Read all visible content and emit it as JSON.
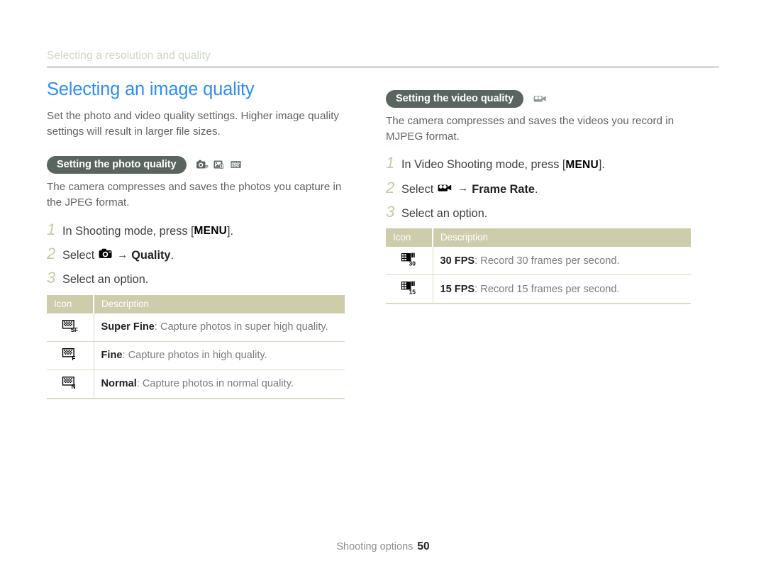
{
  "breadcrumb": "Selecting a resolution and quality",
  "page_title": "Selecting an image quality",
  "intro": "Set the photo and video quality settings. Higher image quality settings will result in larger file sizes.",
  "colors": {
    "heading_blue": "#2e8ef0",
    "badge_slate": "#5b6560",
    "table_header_khaki": "#cdccab",
    "step_number_sage": "#c2cba6",
    "breadcrumb_sage": "#cfd6c4",
    "body_gray": "#636466"
  },
  "photo_section": {
    "badge": "Setting the photo quality",
    "mode_icons": [
      "program-mode-icon",
      "dual-is-mode-icon",
      "scene-mode-icon"
    ],
    "body": "The camera compresses and saves the photos you capture in the JPEG format.",
    "steps": [
      {
        "number": "1",
        "prefix": "In Shooting mode, press [",
        "key": "MENU",
        "suffix": "]."
      },
      {
        "number": "2",
        "prefix": "Select",
        "icon": "camera-icon",
        "arrow": "→",
        "bold": "Quality",
        "suffix": "."
      },
      {
        "number": "3",
        "prefix": "Select an option."
      }
    ],
    "table": {
      "headers": [
        "Icon",
        "Description"
      ],
      "rows": [
        {
          "icon": "photo-super-fine-icon",
          "icon_sub": "SF",
          "term": "Super Fine",
          "desc": ": Capture photos in super high quality."
        },
        {
          "icon": "photo-fine-icon",
          "icon_sub": "F",
          "term": "Fine",
          "desc": ": Capture photos in high quality."
        },
        {
          "icon": "photo-normal-icon",
          "icon_sub": "N",
          "term": "Normal",
          "desc": ": Capture photos in normal quality."
        }
      ]
    }
  },
  "video_section": {
    "badge": "Setting the video quality",
    "mode_icons": [
      "video-mode-icon"
    ],
    "body": "The camera compresses and saves the videos you record in MJPEG format.",
    "steps": [
      {
        "number": "1",
        "prefix": "In Video Shooting mode, press [",
        "key": "MENU",
        "suffix": "]."
      },
      {
        "number": "2",
        "prefix": "Select",
        "icon": "video-camera-icon",
        "arrow": "→",
        "bold": "Frame Rate",
        "suffix": "."
      },
      {
        "number": "3",
        "prefix": "Select an option."
      }
    ],
    "table": {
      "headers": [
        "Icon",
        "Description"
      ],
      "rows": [
        {
          "icon": "film-30fps-icon",
          "icon_sub": "30",
          "term": "30 FPS",
          "desc": ": Record 30 frames per second."
        },
        {
          "icon": "film-15fps-icon",
          "icon_sub": "15",
          "term": "15 FPS",
          "desc": ": Record 15 frames per second."
        }
      ]
    }
  },
  "footer": {
    "label": "Shooting options",
    "page_number": "50"
  }
}
